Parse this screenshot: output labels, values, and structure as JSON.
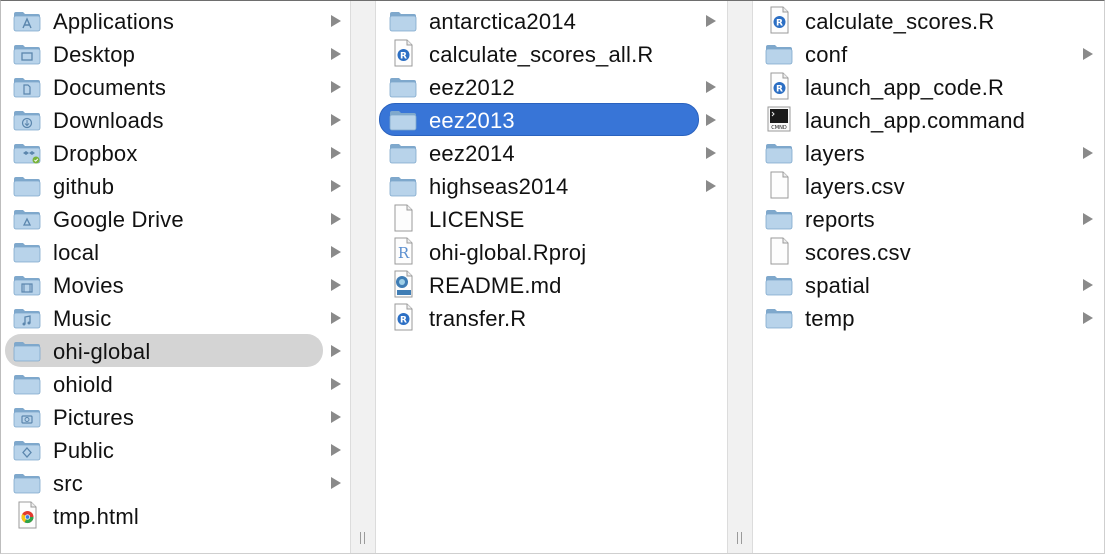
{
  "columns": [
    {
      "items": [
        {
          "label": "Applications",
          "icon": "applications-folder-icon",
          "folder": true
        },
        {
          "label": "Desktop",
          "icon": "desktop-folder-icon",
          "folder": true
        },
        {
          "label": "Documents",
          "icon": "documents-folder-icon",
          "folder": true
        },
        {
          "label": "Downloads",
          "icon": "downloads-folder-icon",
          "folder": true
        },
        {
          "label": "Dropbox",
          "icon": "dropbox-folder-icon",
          "folder": true
        },
        {
          "label": "github",
          "icon": "folder-icon",
          "folder": true
        },
        {
          "label": "Google Drive",
          "icon": "google-drive-folder-icon",
          "folder": true
        },
        {
          "label": "local",
          "icon": "folder-icon",
          "folder": true
        },
        {
          "label": "Movies",
          "icon": "movies-folder-icon",
          "folder": true
        },
        {
          "label": "Music",
          "icon": "music-folder-icon",
          "folder": true
        },
        {
          "label": "ohi-global",
          "icon": "folder-icon",
          "folder": true,
          "state": "path"
        },
        {
          "label": "ohiold",
          "icon": "folder-icon",
          "folder": true
        },
        {
          "label": "Pictures",
          "icon": "pictures-folder-icon",
          "folder": true
        },
        {
          "label": "Public",
          "icon": "public-folder-icon",
          "folder": true
        },
        {
          "label": "src",
          "icon": "folder-icon",
          "folder": true
        },
        {
          "label": "tmp.html",
          "icon": "chrome-html-file-icon",
          "folder": false
        }
      ]
    },
    {
      "items": [
        {
          "label": "antarctica2014",
          "icon": "folder-icon",
          "folder": true
        },
        {
          "label": "calculate_scores_all.R",
          "icon": "r-script-file-icon",
          "folder": false
        },
        {
          "label": "eez2012",
          "icon": "folder-icon",
          "folder": true
        },
        {
          "label": "eez2013",
          "icon": "folder-icon",
          "folder": true,
          "state": "selected"
        },
        {
          "label": "eez2014",
          "icon": "folder-icon",
          "folder": true
        },
        {
          "label": "highseas2014",
          "icon": "folder-icon",
          "folder": true
        },
        {
          "label": "LICENSE",
          "icon": "document-file-icon",
          "folder": false
        },
        {
          "label": "ohi-global.Rproj",
          "icon": "rproj-file-icon",
          "folder": false
        },
        {
          "label": "README.md",
          "icon": "markdown-file-icon",
          "folder": false
        },
        {
          "label": "transfer.R",
          "icon": "r-script-file-icon",
          "folder": false
        }
      ]
    },
    {
      "items": [
        {
          "label": "calculate_scores.R",
          "icon": "r-script-file-icon",
          "folder": false
        },
        {
          "label": "conf",
          "icon": "folder-icon",
          "folder": true
        },
        {
          "label": "launch_app_code.R",
          "icon": "r-script-file-icon",
          "folder": false
        },
        {
          "label": "launch_app.command",
          "icon": "terminal-command-file-icon",
          "folder": false
        },
        {
          "label": "layers",
          "icon": "folder-icon",
          "folder": true
        },
        {
          "label": "layers.csv",
          "icon": "document-file-icon",
          "folder": false
        },
        {
          "label": "reports",
          "icon": "folder-icon",
          "folder": true
        },
        {
          "label": "scores.csv",
          "icon": "document-file-icon",
          "folder": false
        },
        {
          "label": "spatial",
          "icon": "folder-icon",
          "folder": true
        },
        {
          "label": "temp",
          "icon": "folder-icon",
          "folder": true
        }
      ]
    }
  ],
  "colors": {
    "selection": "#3875d7",
    "path_highlight": "#d4d4d4",
    "folder_light": "#b8d3ea",
    "folder_dark": "#7fa8cc",
    "arrow": "#8a8a8a",
    "r_blue": "#2c6fc4"
  }
}
